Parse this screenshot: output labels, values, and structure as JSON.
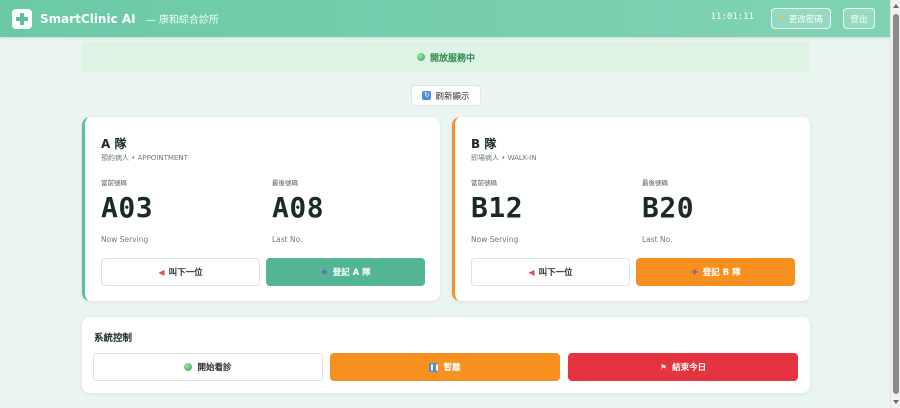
{
  "header": {
    "brand": "SmartClinic AI",
    "clinic": "— 康和綜合診所",
    "clock": "11:01:11",
    "change_password": "更改密碼",
    "logout": "登出"
  },
  "status": {
    "text": "開放服務中"
  },
  "refresh": {
    "label": "刷新顯示"
  },
  "queues": [
    {
      "title": "A 隊",
      "subtitle": "預約病人 • APPOINTMENT",
      "current_label": "當前號碼",
      "current": "A03",
      "current_caption": "Now Serving",
      "last_label": "最後號碼",
      "last": "A08",
      "last_caption": "Last No.",
      "next_button": "叫下一位",
      "register_button": "登記 A 隊",
      "accent": "#52b694"
    },
    {
      "title": "B 隊",
      "subtitle": "即場病人 • WALK-IN",
      "current_label": "當前號碼",
      "current": "B12",
      "current_caption": "Now Serving",
      "last_label": "最後號碼",
      "last": "B20",
      "last_caption": "Last No.",
      "next_button": "叫下一位",
      "register_button": "登記 B 隊",
      "accent": "#f7901e"
    }
  ],
  "system": {
    "title": "系統控制",
    "start": "開始看診",
    "pause": "暫離",
    "end": "結束今日"
  },
  "icons": {
    "logo": "medical-cross-icon",
    "key": "key-icon",
    "status": "green-dot-icon",
    "refresh": "refresh-icon",
    "next": "megaphone-icon",
    "register": "plus-icon",
    "pause": "pause-icon",
    "end": "flag-icon"
  }
}
